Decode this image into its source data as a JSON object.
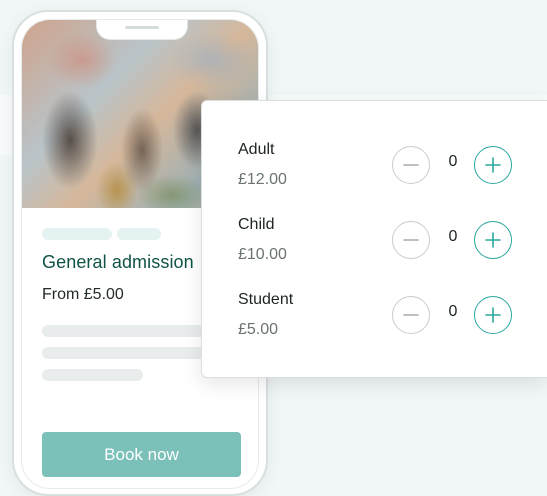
{
  "event": {
    "title": "General admission",
    "price_from": "From £5.00",
    "book_label": "Book now"
  },
  "tickets": [
    {
      "name": "Adult",
      "price": "£12.00",
      "quantity": "0"
    },
    {
      "name": "Child",
      "price": "£10.00",
      "quantity": "0"
    },
    {
      "name": "Student",
      "price": "£5.00",
      "quantity": "0"
    }
  ],
  "icons": {
    "decrease": "minus-icon",
    "increase": "plus-icon"
  },
  "colors": {
    "brand_dark": "#0f5247",
    "accent": "#2aa89c",
    "button": "#7cc0ba",
    "background": "#f1f7f7"
  }
}
